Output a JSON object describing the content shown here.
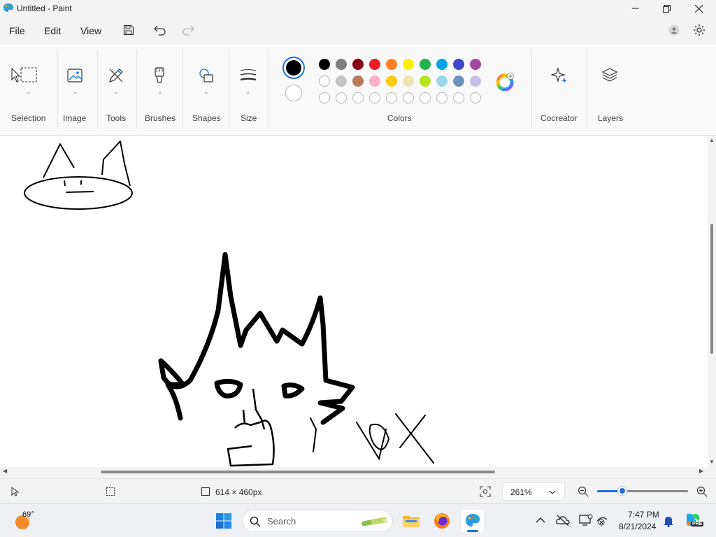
{
  "window": {
    "title": "Untitled - Paint"
  },
  "menu": {
    "file": "File",
    "edit": "Edit",
    "view": "View"
  },
  "ribbon": {
    "selection": "Selection",
    "image": "Image",
    "tools": "Tools",
    "brushes": "Brushes",
    "shapes": "Shapes",
    "size": "Size",
    "colors": "Colors",
    "cocreator": "Cocreator",
    "layers": "Layers"
  },
  "colors": {
    "primary": "#000000",
    "secondary": "#ffffff",
    "palette_row1": [
      "#000000",
      "#7f7f7f",
      "#880015",
      "#ed1c24",
      "#ff7f27",
      "#fff200",
      "#22b14c",
      "#00a2e8",
      "#3f48cc",
      "#a349a4"
    ],
    "palette_row2": [
      "#ffffff",
      "#c3c3c3",
      "#b97a57",
      "#ffaec9",
      "#ffc90e",
      "#efe4b0",
      "#b5e61d",
      "#99d9ea",
      "#7092be",
      "#c8bfe7"
    ],
    "custom_slots": 10
  },
  "status": {
    "canvas_size": "614 × 460px",
    "zoom": "261%",
    "zoom_slider_fraction": 0.28
  },
  "taskbar": {
    "weather_temp": "69°",
    "search_placeholder": "Search",
    "time": "7:47 PM",
    "date": "8/21/2024",
    "copilot_badge": "PRE"
  },
  "canvas_text": {
    "handwritten": "vox"
  }
}
